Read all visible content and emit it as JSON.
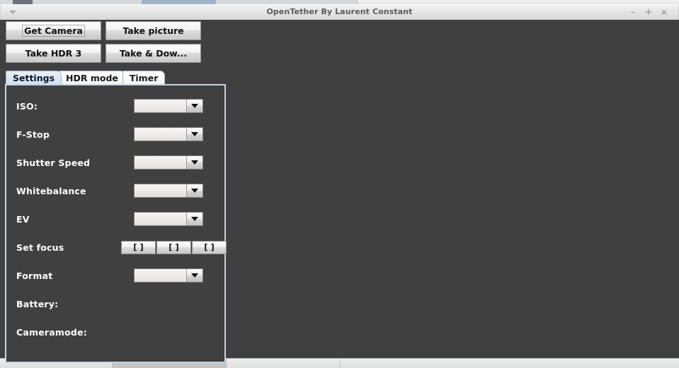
{
  "window": {
    "title": "OpenTether By Laurent Constant",
    "menu_icon": "chevron-down-icon",
    "controls": {
      "minimize": "–",
      "maximize": "+",
      "close": "✕"
    }
  },
  "toolbar": {
    "buttons": [
      {
        "label": "Get Camera",
        "focused": true
      },
      {
        "label": "Take picture",
        "focused": false
      },
      {
        "label": "Take HDR 3",
        "focused": false
      },
      {
        "label": "Take & Dow...",
        "focused": false
      }
    ]
  },
  "tabs": [
    {
      "label": "Settings",
      "selected": true
    },
    {
      "label": "HDR mode",
      "selected": false
    },
    {
      "label": "Timer",
      "selected": false
    }
  ],
  "settings": {
    "fields": [
      {
        "label": "ISO:",
        "control": "combobox",
        "value": ""
      },
      {
        "label": "F-Stop",
        "control": "combobox",
        "value": ""
      },
      {
        "label": "Shutter Speed",
        "control": "combobox",
        "value": ""
      },
      {
        "label": "Whitebalance",
        "control": "combobox",
        "value": ""
      },
      {
        "label": "EV",
        "control": "combobox",
        "value": ""
      },
      {
        "label": "Set focus",
        "control": "buttons",
        "buttons": [
          "[ ]",
          "[ ]",
          "[ ]"
        ]
      },
      {
        "label": "Format",
        "control": "combobox",
        "value": ""
      },
      {
        "label": "Battery:",
        "control": "text",
        "value": ""
      },
      {
        "label": "Cameramode:",
        "control": "text",
        "value": ""
      }
    ]
  },
  "colors": {
    "panel_background": "#404040",
    "panel_border": "#c5d4e6",
    "selected_tab": "#dbe8f6",
    "titlebar": "#e8e8e8",
    "label_text": "#ffffff"
  }
}
